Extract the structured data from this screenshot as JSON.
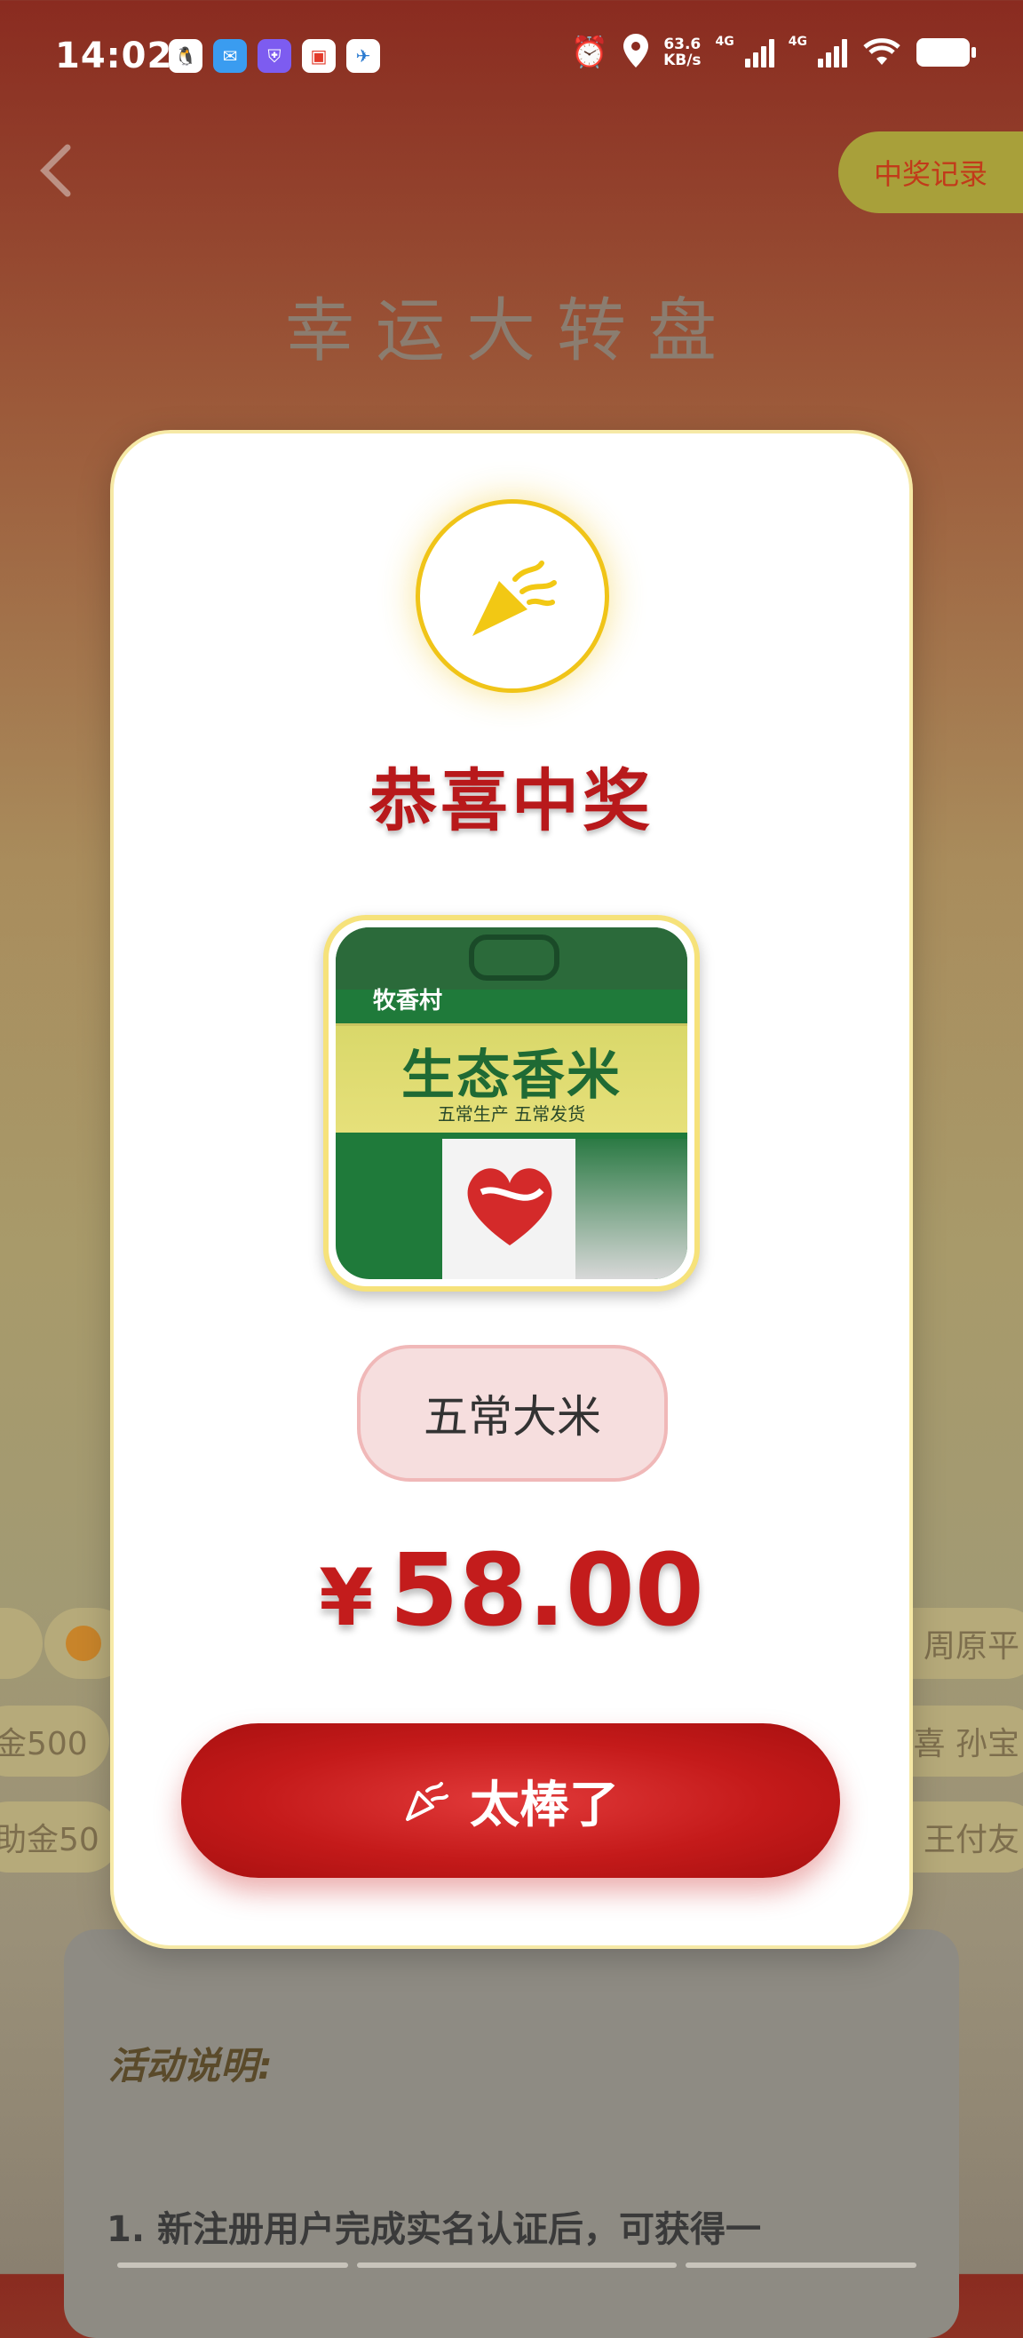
{
  "status_bar": {
    "time": "14:02",
    "network_speed_value": "63.6",
    "network_speed_unit": "KB/s",
    "signal_1": "4G",
    "signal_2": "4G"
  },
  "header": {
    "back_icon": "chevron-left-icon",
    "records_button": "中奖记录",
    "title": "幸运大转盘"
  },
  "tickers": {
    "right_1": "喜 周原平",
    "right_2": "恭喜 孙宝",
    "right_3": "喜 王付友",
    "left_2": "金500",
    "left_3": "助金50"
  },
  "modal": {
    "icon": "party-popper-icon",
    "title": "恭喜中奖",
    "prize_image": {
      "brand": "牧香村",
      "product": "生态香米",
      "subtitle": "五常生产 五常发货"
    },
    "prize_name": "五常大米",
    "price_symbol": "¥",
    "price_value": "58.00",
    "confirm_button": "太棒了",
    "accent_color": "#b8191b",
    "highlight_color": "#f0c418"
  },
  "rules": {
    "title": "活动说明:",
    "line_1": "1. 新注册用户完成实名认证后，可获得一"
  }
}
